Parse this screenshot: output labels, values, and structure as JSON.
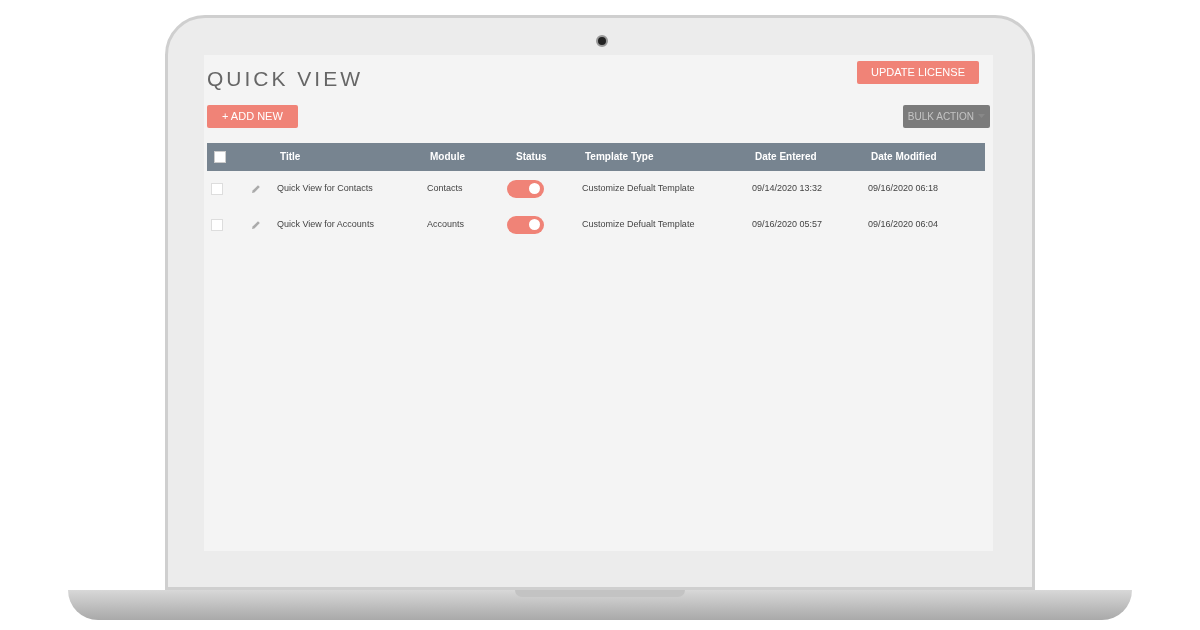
{
  "page_title": "QUICK VIEW",
  "update_license_button": "UPDATE LICENSE",
  "add_new_button": "+ ADD NEW",
  "bulk_action_button": {
    "label": "BULK ACTION",
    "disabled": true
  },
  "table": {
    "select_all": {
      "checked": false
    },
    "columns": [
      "Title",
      "Module",
      "Status",
      "Template Type",
      "Date Entered",
      "Date Modified"
    ],
    "rows": [
      {
        "checked": false,
        "title": "Quick View for Contacts",
        "module": "Contacts",
        "status_on": true,
        "template_type": "Customize Defualt Template",
        "date_entered": "09/14/2020 13:32",
        "date_modified": "09/16/2020 06:18"
      },
      {
        "checked": false,
        "title": "Quick View for Accounts",
        "module": "Accounts",
        "status_on": true,
        "template_type": "Customize Defualt Template",
        "date_entered": "09/16/2020 05:57",
        "date_modified": "09/16/2020 06:04"
      }
    ]
  }
}
